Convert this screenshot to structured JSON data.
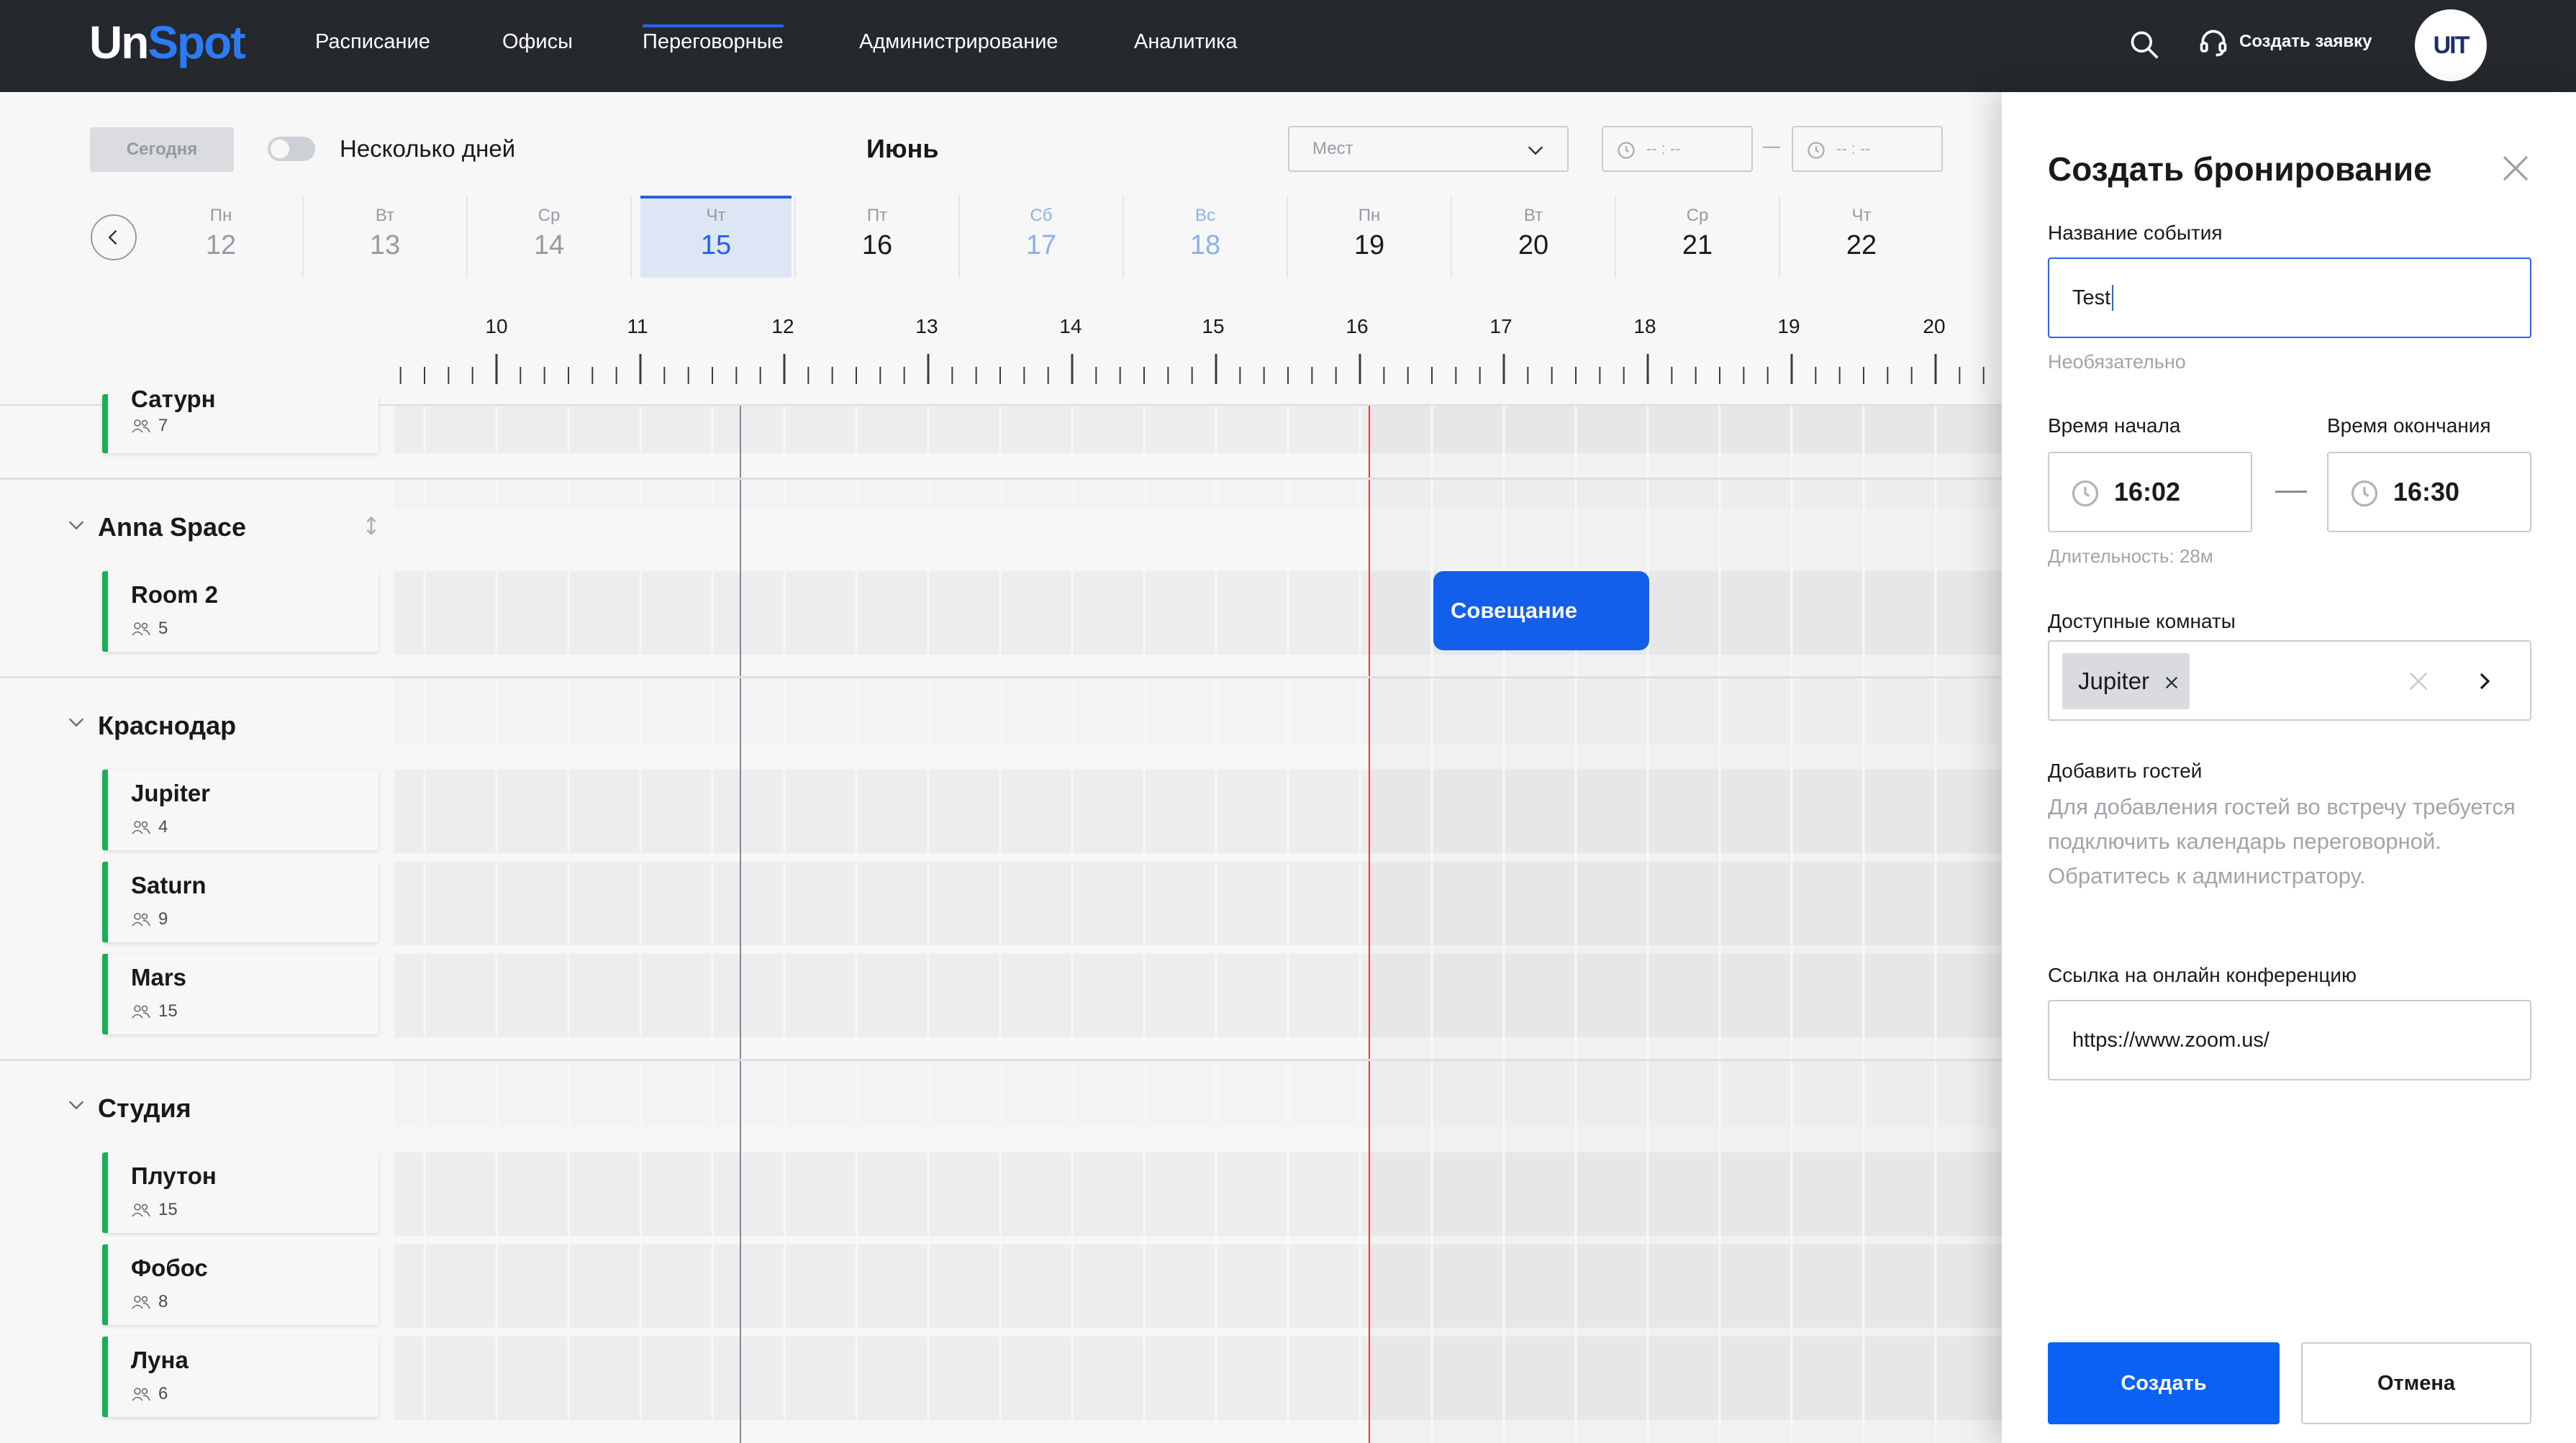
{
  "nav": {
    "logo_a": "Un",
    "logo_b": "Spot",
    "items": [
      "Расписание",
      "Офисы",
      "Переговорные",
      "Администрирование",
      "Аналитика"
    ],
    "active_item": "Переговорные",
    "request_label": "Создать заявку",
    "avatar_text": "UIT"
  },
  "toolbar": {
    "today_label": "Сегодня",
    "multi_days_label": "Несколько дней",
    "multi_days_enabled": false,
    "month": "Июнь",
    "places_placeholder": "Мест",
    "time_from_placeholder": "-- : --",
    "time_to_placeholder": "-- : --",
    "time_dash": "—"
  },
  "days": [
    {
      "dow": "Пн",
      "num": "12",
      "state": "past"
    },
    {
      "dow": "Вт",
      "num": "13",
      "state": "past"
    },
    {
      "dow": "Ср",
      "num": "14",
      "state": "past"
    },
    {
      "dow": "Чт",
      "num": "15",
      "state": "selected"
    },
    {
      "dow": "Пт",
      "num": "16",
      "state": "normal"
    },
    {
      "dow": "Сб",
      "num": "17",
      "state": "weekend"
    },
    {
      "dow": "Вс",
      "num": "18",
      "state": "weekend"
    },
    {
      "dow": "Пн",
      "num": "19",
      "state": "normal"
    },
    {
      "dow": "Вт",
      "num": "20",
      "state": "normal"
    },
    {
      "dow": "Ср",
      "num": "21",
      "state": "normal"
    },
    {
      "dow": "Чт",
      "num": "22",
      "state": "normal"
    }
  ],
  "hours": [
    "10",
    "11",
    "12",
    "13",
    "14",
    "15",
    "16",
    "17",
    "18",
    "19",
    "20"
  ],
  "groups": {
    "partial_room": {
      "name": "Сатурн",
      "capacity": "7"
    },
    "anna": {
      "title": "Anna Space",
      "rooms": [
        {
          "name": "Room 2",
          "capacity": "5"
        }
      ]
    },
    "krasnodar": {
      "title": "Краснодар",
      "rooms": [
        {
          "name": "Jupiter",
          "capacity": "4"
        },
        {
          "name": "Saturn",
          "capacity": "9"
        },
        {
          "name": "Mars",
          "capacity": "15"
        }
      ]
    },
    "studio": {
      "title": "Студия",
      "rooms": [
        {
          "name": "Плутон",
          "capacity": "15"
        },
        {
          "name": "Фобос",
          "capacity": "8"
        },
        {
          "name": "Луна",
          "capacity": "6"
        }
      ]
    }
  },
  "event": {
    "title": "Совещание"
  },
  "panel": {
    "title": "Создать бронирование",
    "event_name_label": "Название события",
    "event_name_value": "Test",
    "event_name_hint": "Необязательно",
    "start_label": "Время начала",
    "end_label": "Время окончания",
    "start_value": "16:02",
    "end_value": "16:30",
    "duration": "Длительность: 28м",
    "rooms_label": "Доступные комнаты",
    "selected_room": "Jupiter",
    "guests_label": "Добавить гостей",
    "guests_text": "Для добавления гостей во встречу требуется подключить календарь переговорной. Обратитесь к администратору.",
    "conf_label": "Ссылка на онлайн конференцию",
    "conf_value": "https://www.zoom.us/",
    "create_label": "Создать",
    "cancel_label": "Отмена"
  },
  "colors": {
    "topbar": "#25282c",
    "accent": "#2a62f0",
    "event": "#1463f3",
    "room_status": "#1db35c",
    "now_line": "#e64545"
  }
}
